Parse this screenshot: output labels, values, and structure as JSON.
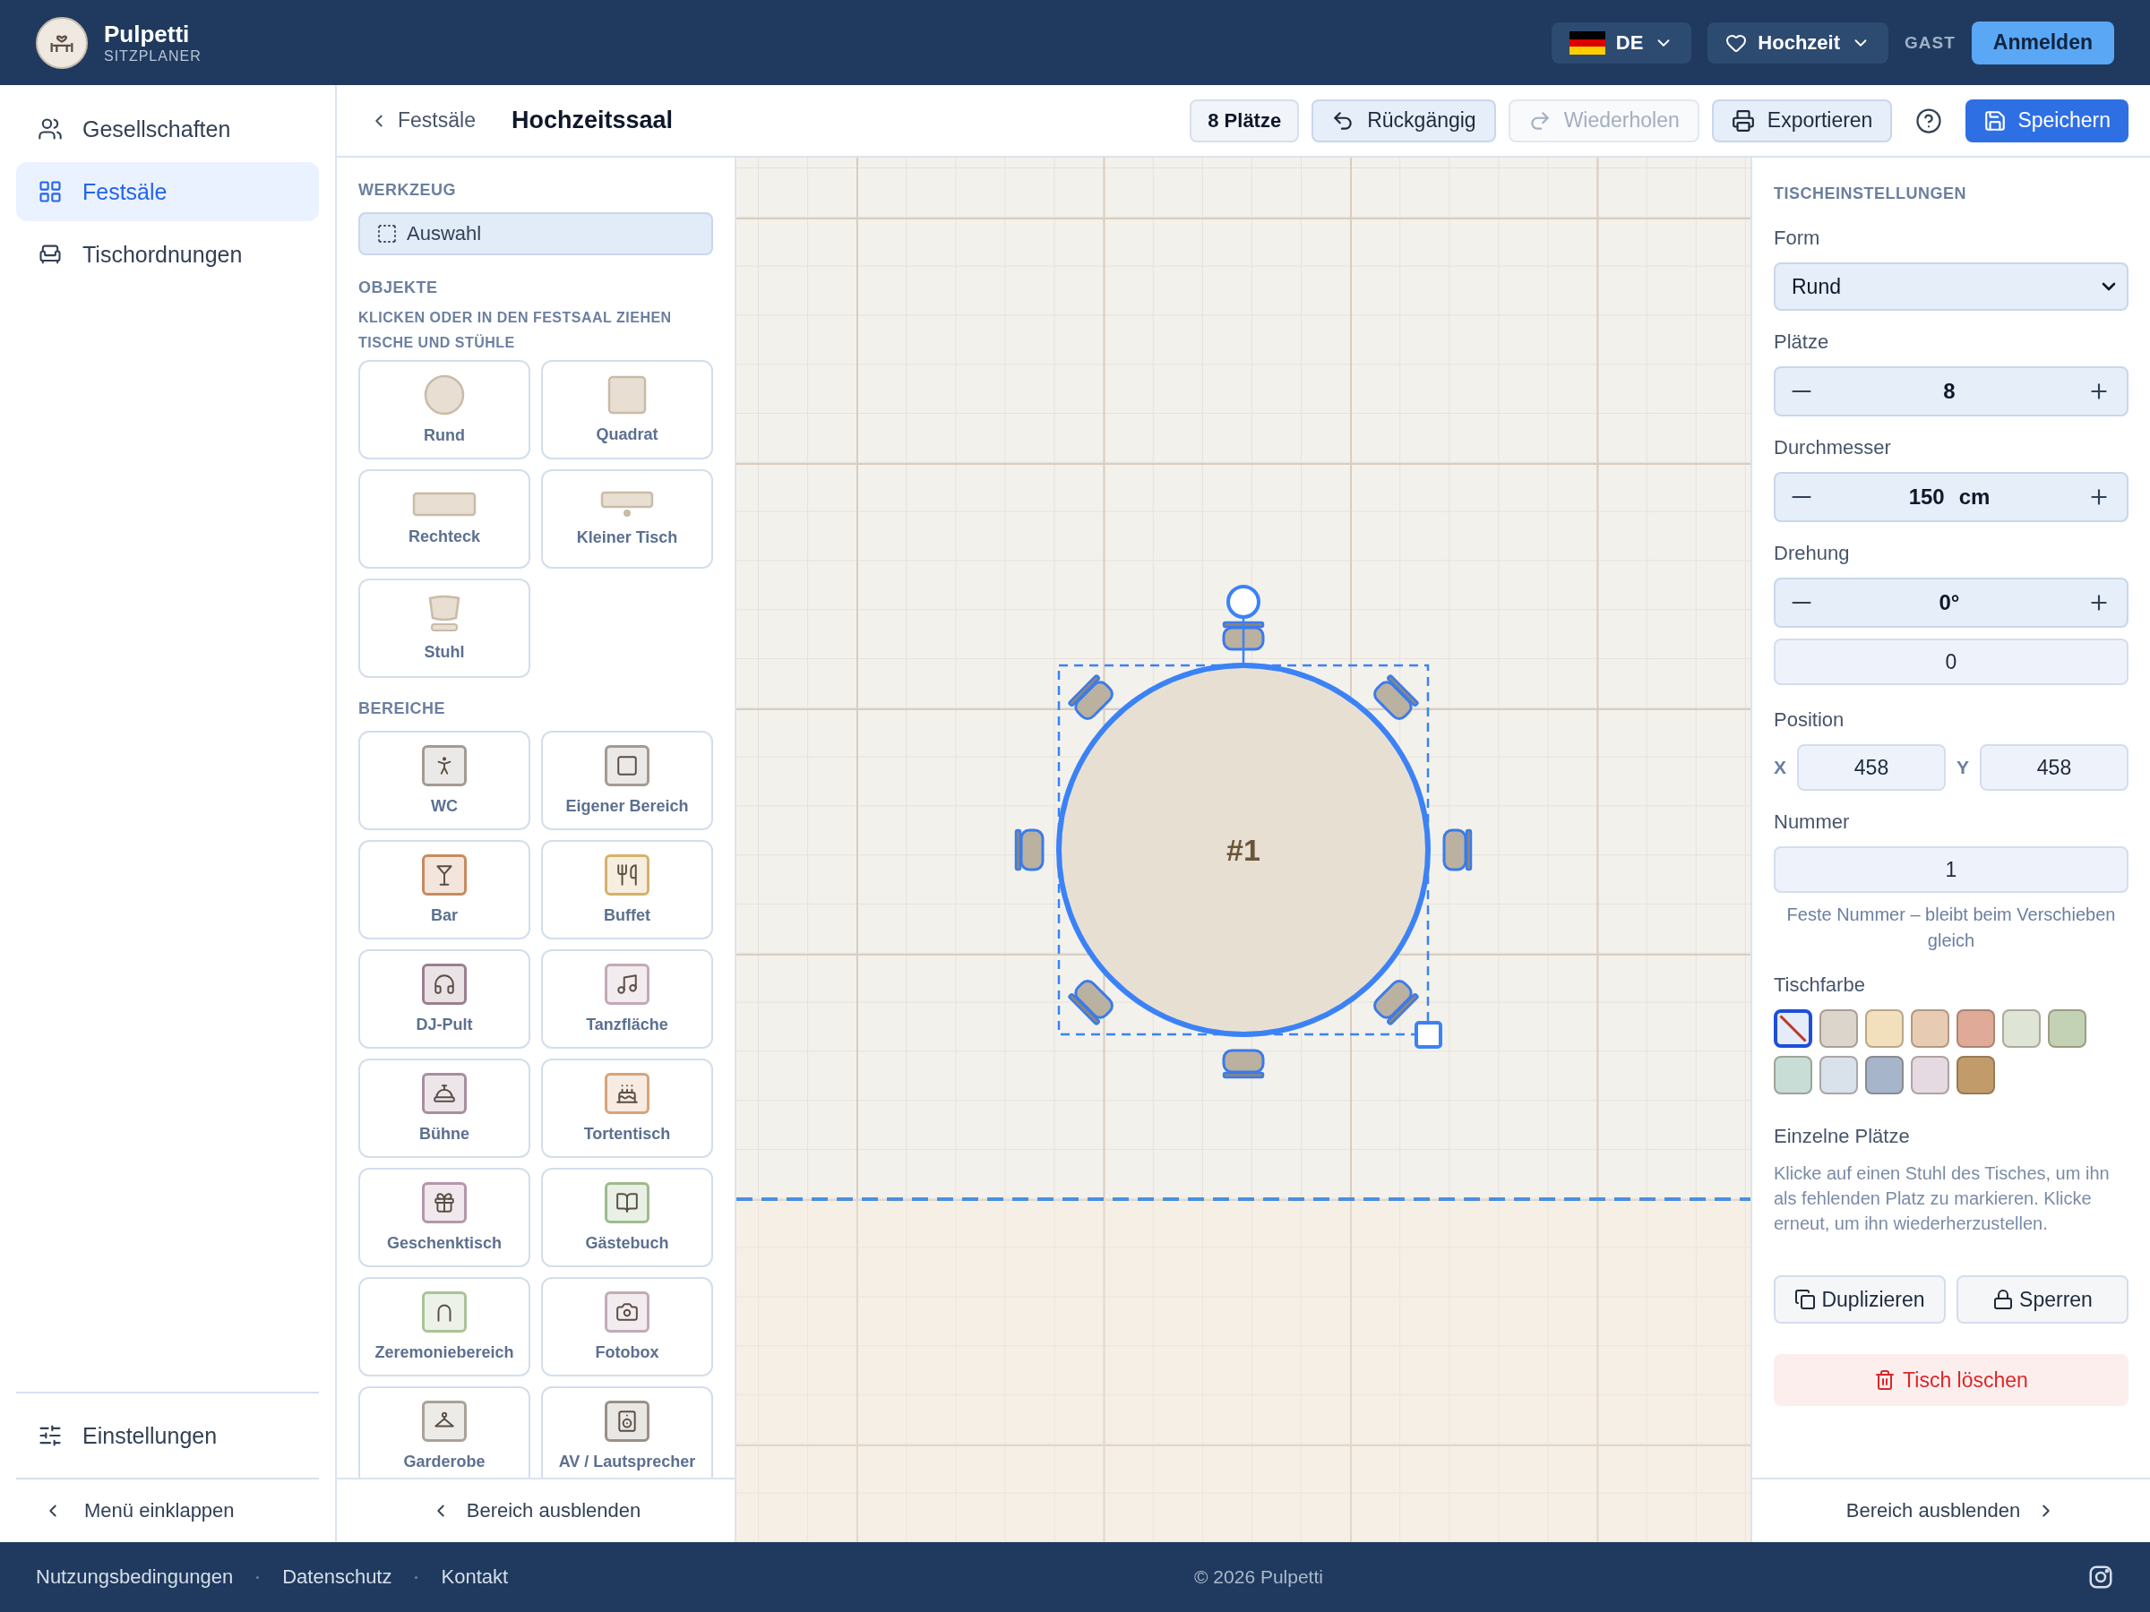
{
  "header": {
    "brand": "Pulpetti",
    "tagline": "SITZPLANER",
    "language": {
      "code": "DE"
    },
    "event": {
      "label": "Hochzeit"
    },
    "role": "GAST",
    "login": "Anmelden"
  },
  "sidebar": {
    "items": [
      {
        "kind": "users",
        "label": "Gesellschaften",
        "selected": false
      },
      {
        "kind": "grid",
        "label": "Festsäle",
        "selected": true
      },
      {
        "kind": "seat",
        "label": "Tischordnungen",
        "selected": false
      }
    ],
    "settings": "Einstellungen",
    "collapse": "Menü einklappen"
  },
  "toolbar": {
    "back": "Festsäle",
    "title": "Hochzeitssaal",
    "seats_badge": "8 Plätze",
    "buttons": [
      {
        "kind": "undo",
        "label": "Rückgängig",
        "disabled": false
      },
      {
        "kind": "redo",
        "label": "Wiederholen",
        "disabled": true
      },
      {
        "kind": "print",
        "label": "Exportieren",
        "disabled": false
      }
    ],
    "save": "Speichern"
  },
  "tools": {
    "tool_heading": "WERKZEUG",
    "tool": {
      "label": "Auswahl",
      "selected": true
    },
    "objects_heading": "OBJEKTE",
    "objects_hint": "KLICKEN ODER IN DEN FESTSAAL ZIEHEN",
    "tables_heading": "TISCHE UND STÜHLE",
    "objects": [
      {
        "kind": "round",
        "label": "Rund"
      },
      {
        "kind": "square",
        "label": "Quadrat"
      },
      {
        "kind": "rect",
        "label": "Rechteck"
      },
      {
        "kind": "small",
        "label": "Kleiner Tisch"
      },
      {
        "kind": "chair",
        "label": "Stuhl"
      }
    ],
    "areas_heading": "BEREICHE",
    "areas": [
      {
        "kind": "person",
        "label": "WC",
        "color": "#a39b91"
      },
      {
        "kind": "square",
        "label": "Eigener Bereich",
        "color": "#a39b91"
      },
      {
        "kind": "glass",
        "label": "Bar",
        "color": "#c98a5e"
      },
      {
        "kind": "utensils",
        "label": "Buffet",
        "color": "#d4b26a"
      },
      {
        "kind": "headphones",
        "label": "DJ-Pult",
        "color": "#9c7e8f"
      },
      {
        "kind": "music",
        "label": "Tanzfläche",
        "color": "#c3a9b8"
      },
      {
        "kind": "cloche",
        "label": "Bühne",
        "color": "#a88ea0"
      },
      {
        "kind": "cake",
        "label": "Tortentisch",
        "color": "#d9a27a"
      },
      {
        "kind": "gift",
        "label": "Geschenktisch",
        "color": "#b597aa"
      },
      {
        "kind": "book",
        "label": "Gästebuch",
        "color": "#9dbb8d"
      },
      {
        "kind": "arch",
        "label": "Zeremoniebereich",
        "color": "#a8c496"
      },
      {
        "kind": "camera",
        "label": "Fotobox",
        "color": "#c3a9b8"
      },
      {
        "kind": "hanger",
        "label": "Garderobe",
        "color": "#a9a297"
      },
      {
        "kind": "speaker",
        "label": "AV / Lautsprecher",
        "color": "#9a9085"
      }
    ],
    "hide": "Bereich ausblenden"
  },
  "canvas": {
    "table": {
      "label": "#1",
      "selected": true
    }
  },
  "settings": {
    "heading": "TISCHEINSTELLUNGEN",
    "form_label": "Form",
    "form_value": "Rund",
    "seats_label": "Plätze",
    "seats_value": "8",
    "diameter_label": "Durchmesser",
    "diameter_value": "150",
    "diameter_unit": "cm",
    "rotation_label": "Drehung",
    "rotation_value": "0°",
    "rotation_input": "0",
    "position_label": "Position",
    "x_label": "X",
    "x_value": "458",
    "y_label": "Y",
    "y_value": "458",
    "number_label": "Nummer",
    "number_value": "1",
    "number_hint": "Feste Nummer – bleibt beim Verschieben gleich",
    "color_label": "Tischfarbe",
    "colors": [
      {
        "kind": "none",
        "selected": true
      },
      {
        "kind": "swatch",
        "color": "#dbd5cc",
        "selected": false
      },
      {
        "kind": "swatch",
        "color": "#f1e0bb",
        "selected": false
      },
      {
        "kind": "swatch",
        "color": "#e8cbb3",
        "selected": false
      },
      {
        "kind": "swatch",
        "color": "#dfaa98",
        "selected": false
      },
      {
        "kind": "swatch",
        "color": "#dfe5d6",
        "selected": false
      },
      {
        "kind": "swatch",
        "color": "#c3d2b4",
        "selected": false
      },
      {
        "kind": "swatch",
        "color": "#c7ddd6",
        "selected": false
      },
      {
        "kind": "swatch",
        "color": "#d9e1eb",
        "selected": false
      },
      {
        "kind": "swatch",
        "color": "#a6b5ca",
        "selected": false
      },
      {
        "kind": "swatch",
        "color": "#e5d9e2",
        "selected": false
      },
      {
        "kind": "swatch",
        "color": "#c19c6a",
        "selected": false
      }
    ],
    "seats_heading": "Einzelne Plätze",
    "seats_help": "Klicke auf einen Stuhl des Tisches, um ihn als fehlenden Platz zu markieren. Klicke erneut, um ihn wiederherzustellen.",
    "duplicate": "Duplizieren",
    "lock": "Sperren",
    "delete": "Tisch löschen",
    "hide": "Bereich ausblenden"
  },
  "footer": {
    "links": [
      "Nutzungsbedingungen",
      "Datenschutz",
      "Kontakt"
    ],
    "copyright": "© 2026 Pulpetti"
  }
}
